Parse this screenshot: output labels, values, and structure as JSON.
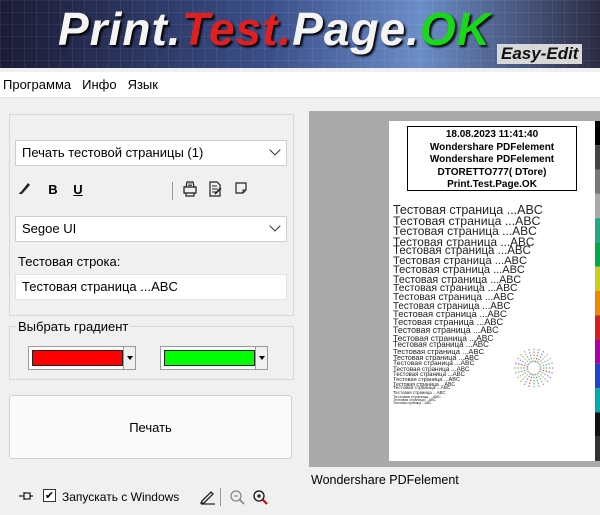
{
  "banner": {
    "title_part1": "Print.",
    "title_part2": "Test.",
    "title_part3": "Page.",
    "title_part4": "OK",
    "subtitle": "Easy-Edit"
  },
  "menu": {
    "items": [
      {
        "label": "Программа"
      },
      {
        "label": "Инфо"
      },
      {
        "label": "Язык"
      }
    ]
  },
  "controls": {
    "mode_select": "Печать тестовой страницы (1)",
    "toolbar": {
      "bold": "B",
      "underline": "U"
    },
    "font_select": "Segoe UI",
    "test_line_label": "Тестовая строка:",
    "test_line_value": "Тестовая страница ...ABC"
  },
  "gradient": {
    "label": "Выбрать градиент",
    "color1": "#ff0000",
    "color2": "#00ff00"
  },
  "print_button": "Печать",
  "bottom": {
    "autostart_label": "Запускать с Windows",
    "autostart_checked": "✔"
  },
  "preview": {
    "header_lines": [
      "18.08.2023 11:41:40",
      "Wondershare PDFelement",
      "Wondershare PDFelement",
      "DTORETTO777( DTore)",
      "Print.Test.Page.OK"
    ],
    "sample_text": "Тестовая страница ...ABC",
    "printer_name": "Wondershare PDFelement"
  }
}
